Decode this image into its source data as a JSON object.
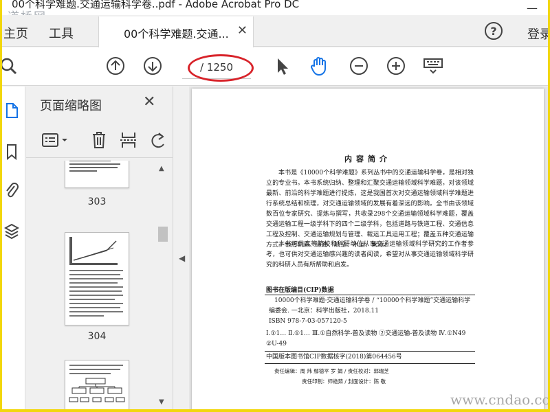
{
  "window": {
    "title": "00个科学难题.交通运输科学卷..pdf - Adobe Acrobat Pro DC",
    "watermark_tl": "道桥网",
    "watermark_br": "www.cndao.com"
  },
  "tabs": {
    "home": "主页",
    "tools": "工具",
    "doc": "00个科学难题.交通..."
  },
  "header": {
    "help": "?",
    "login": "登录"
  },
  "toolbar": {
    "page_display": "/ 1250",
    "icons": [
      "search-icon",
      "prev-page-icon",
      "next-page-icon",
      "select-arrow-icon",
      "hand-tool-icon",
      "zoom-out-icon",
      "zoom-in-icon",
      "keyboard-icon"
    ]
  },
  "sidebar": {
    "panel_title": "页面缩略图",
    "thumbnails": [
      {
        "label": "303"
      },
      {
        "label": "304"
      },
      {
        "label": ""
      }
    ]
  },
  "document": {
    "heading": "内容简介",
    "para1": "本书是《10000个科学难题》系列丛书中的交通运输科学卷，是相对独立的专业书。本书系统归纳、整理和汇聚交通运输领域科学难题，对该领域最新、前沿的科学难题进行提炼，这是我国首次对交通运输领域科学难题进行系统总结和梳理，对交通运输领域的发展有着深远的影响。全书由该领域数百位专家研究、提炼与撰写，共收录298个交通运输领域科学难题，覆盖交通运输工程一级学科下的四个二级学科，包括道路与铁道工程、交通信息工程及控制、交通运输规划与管理、载运工具运用工程；覆盖五种交通运输方式，包括轨道、道路、航空、水运、管道。",
    "para2": "本书可供高等院校和科研单位从事交通运输领域科学研究的工作者参考，也可供对交通运输感兴趣的读者阅读，希望对从事交通运输领域科学研究的科研人员有所帮助和启发。",
    "cip_title": "图书在版编目(CIP)数据",
    "cip_line1": "10000个科学难题·交通运输科学卷 / “10000个科学难题”交通运输科学编委会. 一北京：科学出版社，2018.11",
    "cip_isbn": "ISBN 978-7-03-057120-5",
    "cip_class": "Ⅰ.①1… Ⅱ.①1… Ⅲ.①自然科学-普及读物 ②交通运输-普及读物 Ⅳ.①N49 ②U-49",
    "cip_num": "中国版本图书馆CIP数据核字(2018)第064456号",
    "credit1": "责任编辑：周 炜 鄢德平 罗 娟 / 责任校对：郭瑞芝",
    "credit2": "责任印制：师艳茹 / 封面设计：陈 敬"
  },
  "colors": {
    "accent_blue": "#1473e6",
    "annotation_red": "#d8232a",
    "frame_yellow": "#f2d70a"
  }
}
